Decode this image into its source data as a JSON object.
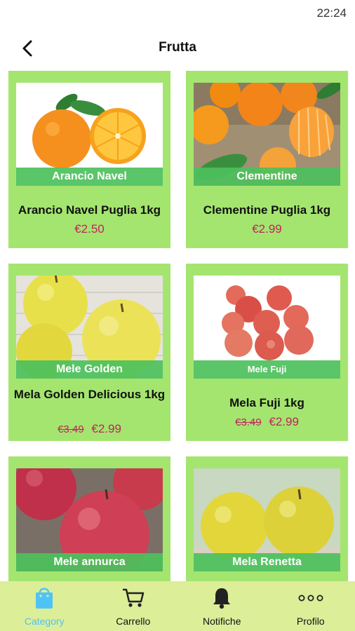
{
  "status_bar": {
    "time": "22:24"
  },
  "header": {
    "title": "Frutta",
    "back_icon": "chevron-left-icon"
  },
  "products": [
    {
      "image_label": "Arancio Navel",
      "name": "Arancio Navel Puglia 1kg",
      "price": "€2.50",
      "old_price": ""
    },
    {
      "image_label": "Clementine",
      "name": "Clementine Puglia 1kg",
      "price": "€2.99",
      "old_price": ""
    },
    {
      "image_label": "Mele Golden",
      "name": "Mela Golden Delicious 1kg",
      "price": "€2.99",
      "old_price": "€3.49"
    },
    {
      "image_label": "Mele Fuji",
      "name": "Mela Fuji 1kg",
      "price": "€2.99",
      "old_price": "€3.49"
    },
    {
      "image_label": "Mele annurca",
      "name": "",
      "price": "",
      "old_price": ""
    },
    {
      "image_label": "Mela Renetta",
      "name": "",
      "price": "",
      "old_price": ""
    }
  ],
  "bottom_nav": [
    {
      "label": "Category",
      "icon": "shopping-bag-icon",
      "active": true
    },
    {
      "label": "Carrello",
      "icon": "cart-icon",
      "active": false
    },
    {
      "label": "Notifiche",
      "icon": "bell-icon",
      "active": false
    },
    {
      "label": "Profilo",
      "icon": "more-dots-icon",
      "active": false
    }
  ],
  "colors": {
    "card_background": "#a4e56f",
    "image_label_background": "#4cc05c",
    "price": "#c0245c",
    "bottom_nav_background": "#dcee98",
    "active_nav": "#4fc3f7"
  }
}
